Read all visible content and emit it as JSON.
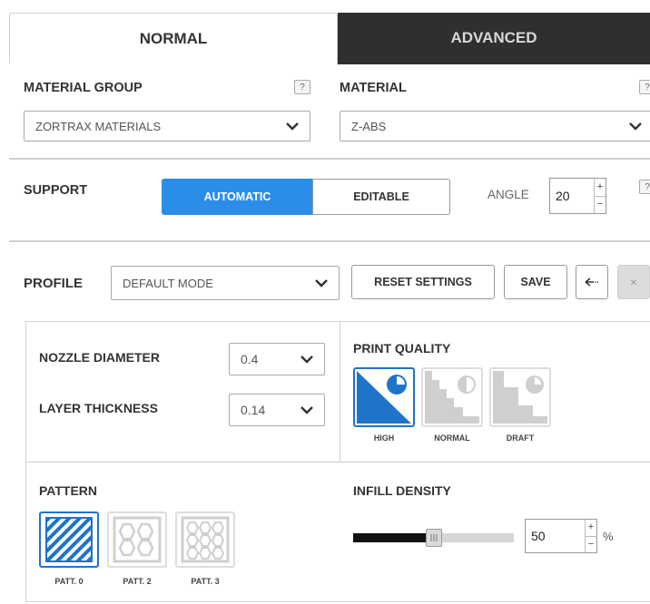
{
  "tabs": {
    "normal": "NORMAL",
    "advanced": "ADVANCED"
  },
  "material_group": {
    "label": "MATERIAL GROUP",
    "help": "?",
    "value": "ZORTRAX MATERIALS"
  },
  "material": {
    "label": "MATERIAL",
    "help": "?",
    "value": "Z-ABS"
  },
  "support": {
    "label": "SUPPORT",
    "automatic": "AUTOMATIC",
    "editable": "EDITABLE",
    "angle_label": "ANGLE",
    "angle_value": "20",
    "plus": "+",
    "minus": "−",
    "help": "?"
  },
  "profile": {
    "label": "PROFILE",
    "value": "DEFAULT MODE",
    "reset": "RESET SETTINGS",
    "save": "SAVE",
    "close": "×"
  },
  "nozzle": {
    "label": "NOZZLE DIAMETER",
    "value": "0.4"
  },
  "layer": {
    "label": "LAYER THICKNESS",
    "value": "0.14"
  },
  "print_quality": {
    "label": "PRINT QUALITY",
    "options": [
      "HIGH",
      "NORMAL",
      "DRAFT"
    ],
    "selected": "HIGH"
  },
  "pattern": {
    "label": "PATTERN",
    "options": [
      "PATT. 0",
      "PATT. 2",
      "PATT. 3"
    ],
    "selected": "PATT. 0"
  },
  "infill": {
    "label": "INFILL DENSITY",
    "value": "50",
    "unit": "%",
    "plus": "+",
    "minus": "−",
    "slider_fraction": 0.5
  },
  "colors": {
    "accent": "#2a8ee8",
    "dark_tab": "#2f2f2f"
  }
}
